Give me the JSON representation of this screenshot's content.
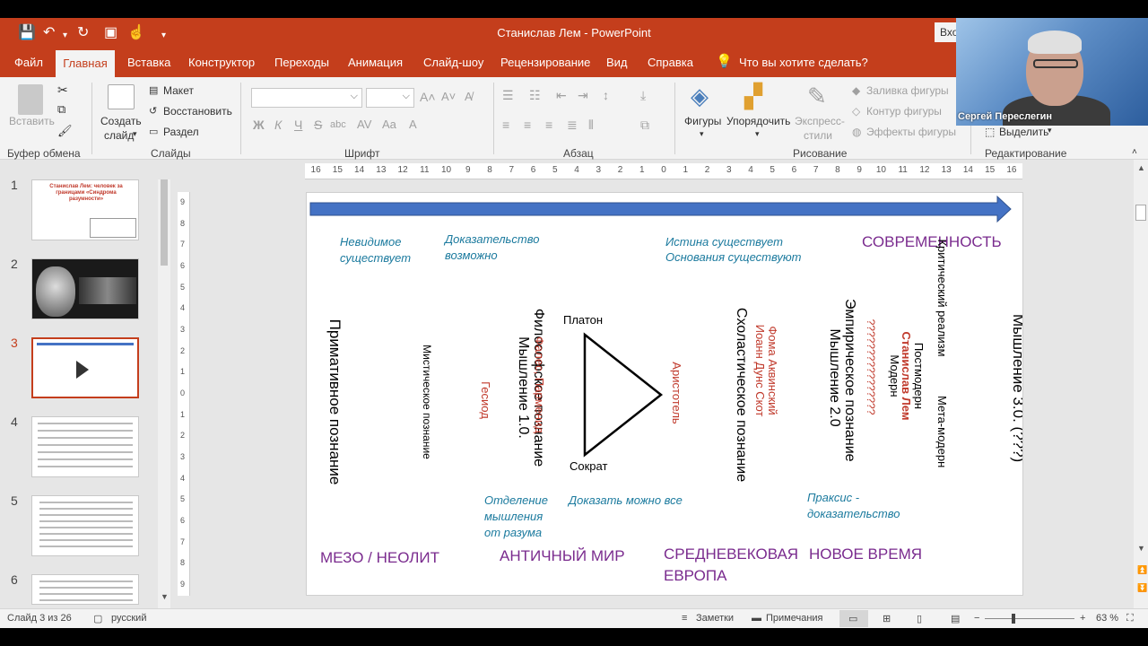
{
  "window": {
    "title": "Станислав Лем  -  PowerPoint",
    "sign_in": "Вход"
  },
  "menu": {
    "tabs": [
      "Файл",
      "Главная",
      "Вставка",
      "Конструктор",
      "Переходы",
      "Анимация",
      "Слайд-шоу",
      "Рецензирование",
      "Вид",
      "Справка"
    ],
    "search_prompt": "Что вы хотите сделать?"
  },
  "ribbon": {
    "clipboard": {
      "paste": "Вставить",
      "group": "Буфер обмена"
    },
    "slides": {
      "new_slide_1": "Создать",
      "new_slide_2": "слайд",
      "layout": "Макет",
      "reset": "Восстановить",
      "section": "Раздел",
      "group": "Слайды"
    },
    "font": {
      "group": "Шрифт",
      "bold": "Ж",
      "italic": "К",
      "underline": "Ч",
      "strike": "S",
      "shadow": "abc"
    },
    "paragraph": {
      "group": "Абзац"
    },
    "drawing": {
      "shapes": "Фигуры",
      "arrange": "Упорядочить",
      "quick_styles_1": "Экспресс-",
      "quick_styles_2": "стили",
      "fill": "Заливка фигуры",
      "outline": "Контур фигуры",
      "effects": "Эффекты фигуры",
      "group": "Рисование"
    },
    "editing": {
      "select": "Выделить",
      "group": "Редактирование"
    }
  },
  "video": {
    "participant": "Сергей Переслегин"
  },
  "thumbnails": {
    "numbers": [
      "1",
      "2",
      "3",
      "4",
      "5",
      "6"
    ],
    "slide1_title": "Станислав Лем: человек за границами «Синдрома разумности»"
  },
  "ruler": {
    "h_ticks": [
      "16",
      "15",
      "14",
      "13",
      "12",
      "11",
      "10",
      "9",
      "8",
      "7",
      "6",
      "5",
      "4",
      "3",
      "2",
      "1",
      "0",
      "1",
      "2",
      "3",
      "4",
      "5",
      "6",
      "7",
      "8",
      "9",
      "10",
      "11",
      "12",
      "13",
      "14",
      "15",
      "16"
    ]
  },
  "slide": {
    "top_labels": {
      "invisible_1": "Невидимое",
      "invisible_2": "существует",
      "proof_1": "Доказательство",
      "proof_2": "возможно",
      "truth_1": "Истина существует",
      "truth_2": "Основания существуют",
      "modernity": "СОВРЕМЕННОСТЬ"
    },
    "vertical": {
      "primitive": "Примативное познание",
      "mystic": "Мистическое познание",
      "philosophic_1": "Философское познание",
      "philosophic_2": "Мышление 1.0.",
      "thales": "Фалес, Парменид",
      "hesiod": "Гесиод",
      "aristotle": "Аристотель",
      "scholastic": "Схоластическое познание",
      "aquinas": "Фома Аквинский",
      "scotus": "Иоанн Дунс Скот",
      "empiric_1": "Эмпирическое познание",
      "empiric_2": "Мышление 2.0",
      "question": "????????????????",
      "postmodern": "Постмодерн",
      "lem": "Станислав Лем",
      "modern": "Модерн",
      "critical": "Критический реализм",
      "metamodern": "Мета-модерн",
      "thinking3": "Мышление 3.0. (???)"
    },
    "triangle": {
      "plato": "Платон",
      "socrates": "Сократ"
    },
    "bottom_labels": {
      "separation_1": "Отделение",
      "separation_2": "мышления",
      "separation_3": "от разума",
      "prove_all": "Доказать можно все",
      "praxis_1": "Праксис -",
      "praxis_2": "доказательство"
    },
    "eras": {
      "meso": "МЕЗО / НЕОЛИТ",
      "antique": "АНТИЧНЫЙ МИР",
      "medieval_1": "СРЕДНЕВЕКОВАЯ",
      "medieval_2": "ЕВРОПА",
      "new_time": "НОВОЕ ВРЕМЯ"
    },
    "arrow_color": "#4472c4"
  },
  "status": {
    "slide_counter": "Слайд 3 из 26",
    "language": "русский",
    "notes": "Заметки",
    "comments": "Примечания",
    "zoom": "63 %",
    "zoom_fraction": 0.63
  },
  "colors": {
    "accent": "#c43e1c",
    "italic_blue": "#1b7a9e",
    "era_purple": "#7a2b8e",
    "name_red": "#c0392b"
  }
}
